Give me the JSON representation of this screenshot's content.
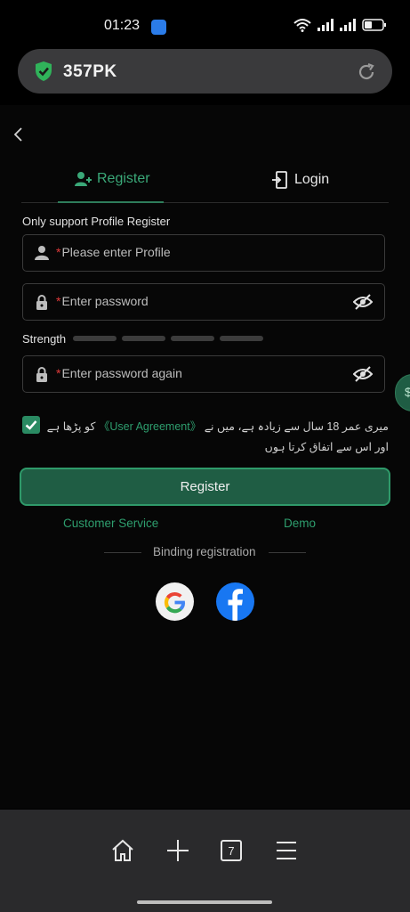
{
  "status_bar": {
    "time": "01:23"
  },
  "browser": {
    "url_text": "357PK",
    "tab_count": "7"
  },
  "tabs": [
    {
      "label": "Register",
      "active": true
    },
    {
      "label": "Login",
      "active": false
    }
  ],
  "form": {
    "note": "Only support Profile Register",
    "profile_placeholder": "Please enter Profile",
    "password_placeholder": "Enter password",
    "password_again_placeholder": "Enter password again",
    "required_mark": "*",
    "strength_label": "Strength",
    "strength_level": 0,
    "strength_segments": 4
  },
  "agreement": {
    "checked": true,
    "text_before": "میری عمر 18 سال سے زیادہ ہے، میں نے ",
    "link": "《User Agreement》",
    "text_after": " کو پڑھا ہے",
    "line2": "اور اس سے اتفاق کرتا ہوں"
  },
  "actions": {
    "register_button": "Register",
    "customer_service": "Customer Service",
    "demo": "Demo"
  },
  "binding": {
    "label": "Binding registration"
  },
  "colors": {
    "accent": "#2e9e6e",
    "button_bg": "#1f5d44",
    "required": "#e03a3a"
  }
}
